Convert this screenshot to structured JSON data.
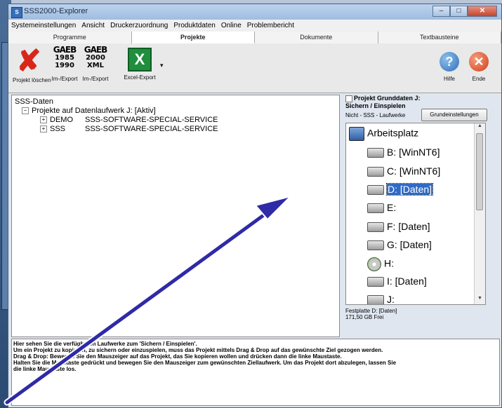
{
  "window": {
    "title": "SSS2000-Explorer"
  },
  "menu": [
    "Systemeinstellungen",
    "Ansicht",
    "Druckerzuordnung",
    "Produktdaten",
    "Online",
    "Problembericht"
  ],
  "tabs": [
    "Programme",
    "Projekte",
    "Dokumente",
    "Textbausteine"
  ],
  "active_tab": "Projekte",
  "toolbar": {
    "delete_label": "Projekt löschen",
    "gaeb1_logo": "GAEB",
    "gaeb1_top": "1985",
    "gaeb1_bottom": "1990",
    "gaeb1_label": "Im-/Export",
    "gaeb2_logo": "GAEB",
    "gaeb2_top": "2000",
    "gaeb2_bottom": "XML",
    "gaeb2_label": "Im-/Export",
    "excel_label": "Excel-Export",
    "help_label": "Hilfe",
    "exit_label": "Ende"
  },
  "tree": {
    "root": "SSS-Daten",
    "drive": "Projekte auf Datenlaufwerk J: [Aktiv]",
    "projects": [
      {
        "code": "DEMO",
        "name": "SSS-SOFTWARE-SPECIAL-SERVICE"
      },
      {
        "code": "SSS",
        "name": "SSS-SOFTWARE-SPECIAL-SERVICE"
      }
    ]
  },
  "right": {
    "checkbox_label_1": "Projekt Grunddaten J:",
    "checkbox_label_2": "Sichern / Einspielen",
    "nicht_label": "Nicht - SSS - Laufwerke",
    "grund_button": "Grundeinstellungen",
    "drives": [
      {
        "label": "Arbeitsplatz",
        "icon": "computer-icon"
      },
      {
        "label": "B: [WinNT6]",
        "icon": "drive-icon"
      },
      {
        "label": "C: [WinNT6]",
        "icon": "drive-icon"
      },
      {
        "label": "D: [Daten]",
        "icon": "drive-icon",
        "selected": true
      },
      {
        "label": "E:",
        "icon": "network-drive-icon"
      },
      {
        "label": "F: [Daten]",
        "icon": "network-drive-icon"
      },
      {
        "label": "G: [Daten]",
        "icon": "network-drive-icon"
      },
      {
        "label": "H:",
        "icon": "cd-drive-icon"
      },
      {
        "label": "I: [Daten]",
        "icon": "network-drive-icon"
      },
      {
        "label": "J:",
        "icon": "network-drive-icon"
      }
    ],
    "disk_info_1": "Festplatte D: [Daten]",
    "disk_info_2": "171,50  GB Frei"
  },
  "info": [
    "Hier sehen Sie die verfügbaren Laufwerke zum 'Sichern / Einspielen'.",
    "Um ein Projekt zu kopieren, zu sichern oder einzuspielen, muss das Projekt mittels Drag & Drop auf das gewünschte Ziel gezogen werden.",
    "Drag & Drop: Bewegen Sie den Mauszeiger auf das Projekt, das Sie kopieren wollen und drücken dann die linke Maustaste.",
    "Halten Sie die Maustaste gedrückt und bewegen Sie den Mauszeiger zum gewünschten Ziellaufwerk. Um das Projekt dort abzulegen, lassen Sie",
    "die linke Maustaste los."
  ],
  "colors": {
    "accent": "#316ac5",
    "arrow": "#2f2aa6"
  }
}
